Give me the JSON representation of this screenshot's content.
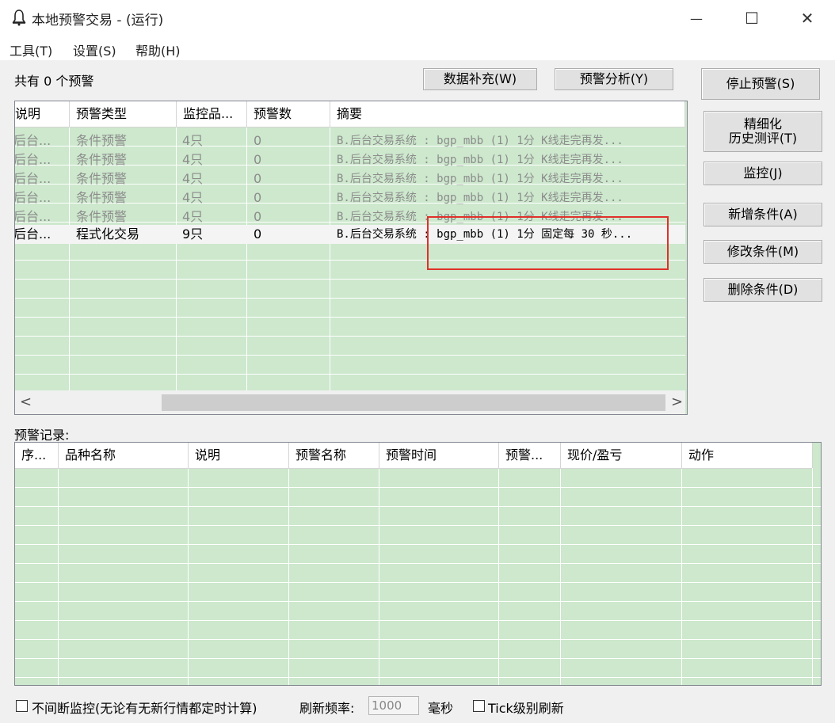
{
  "window": {
    "title": "本地预警交易 - (运行)",
    "minimize_glyph": "—",
    "maximize_glyph": "☐",
    "close_glyph": "✕"
  },
  "menu": [
    "工具(T)",
    "设置(S)",
    "帮助(H)"
  ],
  "summary": "共有 0 个预警",
  "buttons": {
    "data_fill": "数据补充(W)",
    "alert_analysis": "预警分析(Y)",
    "stop_alert": "停止预警(S)",
    "refine_line1": "精细化",
    "refine_line2": "历史测评(T)",
    "monitor": "监控(J)",
    "add_condition": "新增条件(A)",
    "modify_condition": "修改条件(M)",
    "delete_condition": "删除条件(D)"
  },
  "alert_table": {
    "columns": [
      "说明",
      "预警类型",
      "监控品...",
      "预警数",
      "摘要"
    ],
    "rows": [
      {
        "desc": "后台...",
        "type": "条件预警",
        "monitor": "4只",
        "count": "0",
        "summary": "B.后台交易系统 : bgp_mbb (1) 1分 K线走完再发...",
        "state": "grey"
      },
      {
        "desc": "后台...",
        "type": "条件预警",
        "monitor": "4只",
        "count": "0",
        "summary": "B.后台交易系统 : bgp_mbb (1) 1分 K线走完再发...",
        "state": "grey"
      },
      {
        "desc": "后台...",
        "type": "条件预警",
        "monitor": "4只",
        "count": "0",
        "summary": "B.后台交易系统 : bgp_mbb (1) 1分 K线走完再发...",
        "state": "grey"
      },
      {
        "desc": "后台...",
        "type": "条件预警",
        "monitor": "4只",
        "count": "0",
        "summary": "B.后台交易系统 : bgp_mbb (1) 1分 K线走完再发...",
        "state": "grey"
      },
      {
        "desc": "后台...",
        "type": "条件预警",
        "monitor": "4只",
        "count": "0",
        "summary": "B.后台交易系统 : bgp_mbb (1) 1分 K线走完再发...",
        "state": "grey"
      },
      {
        "desc": "后台...",
        "type": "程式化交易",
        "monitor": "9只",
        "count": "0",
        "summary": "B.后台交易系统 : bgp_mbb (1) 1分 固定每 30 秒...",
        "state": "active"
      }
    ],
    "scroll_left": "<",
    "scroll_right": ">"
  },
  "records": {
    "label": "预警记录:",
    "columns": [
      "序...",
      "品种名称",
      "说明",
      "预警名称",
      "预警时间",
      "预警...",
      "现价/盈亏",
      "动作"
    ]
  },
  "footer": {
    "continuous_label": "不间断监控(无论有无新行情都定时计算)",
    "refresh_label": "刷新频率:",
    "refresh_value": "1000",
    "unit": "毫秒",
    "tick_label": "Tick级别刷新"
  },
  "colors": {
    "grid_bg": "#cde8cd",
    "highlight_box": "#e0302a"
  }
}
